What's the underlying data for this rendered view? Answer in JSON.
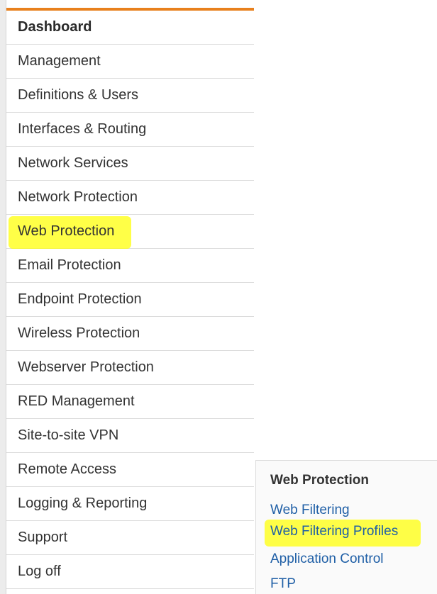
{
  "navigation": {
    "items": [
      {
        "label": "Dashboard"
      },
      {
        "label": "Management"
      },
      {
        "label": "Definitions & Users"
      },
      {
        "label": "Interfaces & Routing"
      },
      {
        "label": "Network Services"
      },
      {
        "label": "Network Protection"
      },
      {
        "label": "Web Protection",
        "highlighted": true
      },
      {
        "label": "Email Protection"
      },
      {
        "label": "Endpoint Protection"
      },
      {
        "label": "Wireless Protection"
      },
      {
        "label": "Webserver Protection"
      },
      {
        "label": "RED Management"
      },
      {
        "label": "Site-to-site VPN"
      },
      {
        "label": "Remote Access"
      },
      {
        "label": "Logging & Reporting"
      },
      {
        "label": "Support"
      },
      {
        "label": "Log off"
      }
    ]
  },
  "submenu": {
    "title": "Web Protection",
    "items": [
      {
        "label": "Web Filtering"
      },
      {
        "label": "Web Filtering Profiles",
        "highlighted": true
      },
      {
        "label": "Application Control"
      },
      {
        "label": "FTP"
      }
    ]
  },
  "colors": {
    "accent": "#e8801d",
    "link": "#1f5fa6",
    "highlight": "#ffff00"
  }
}
